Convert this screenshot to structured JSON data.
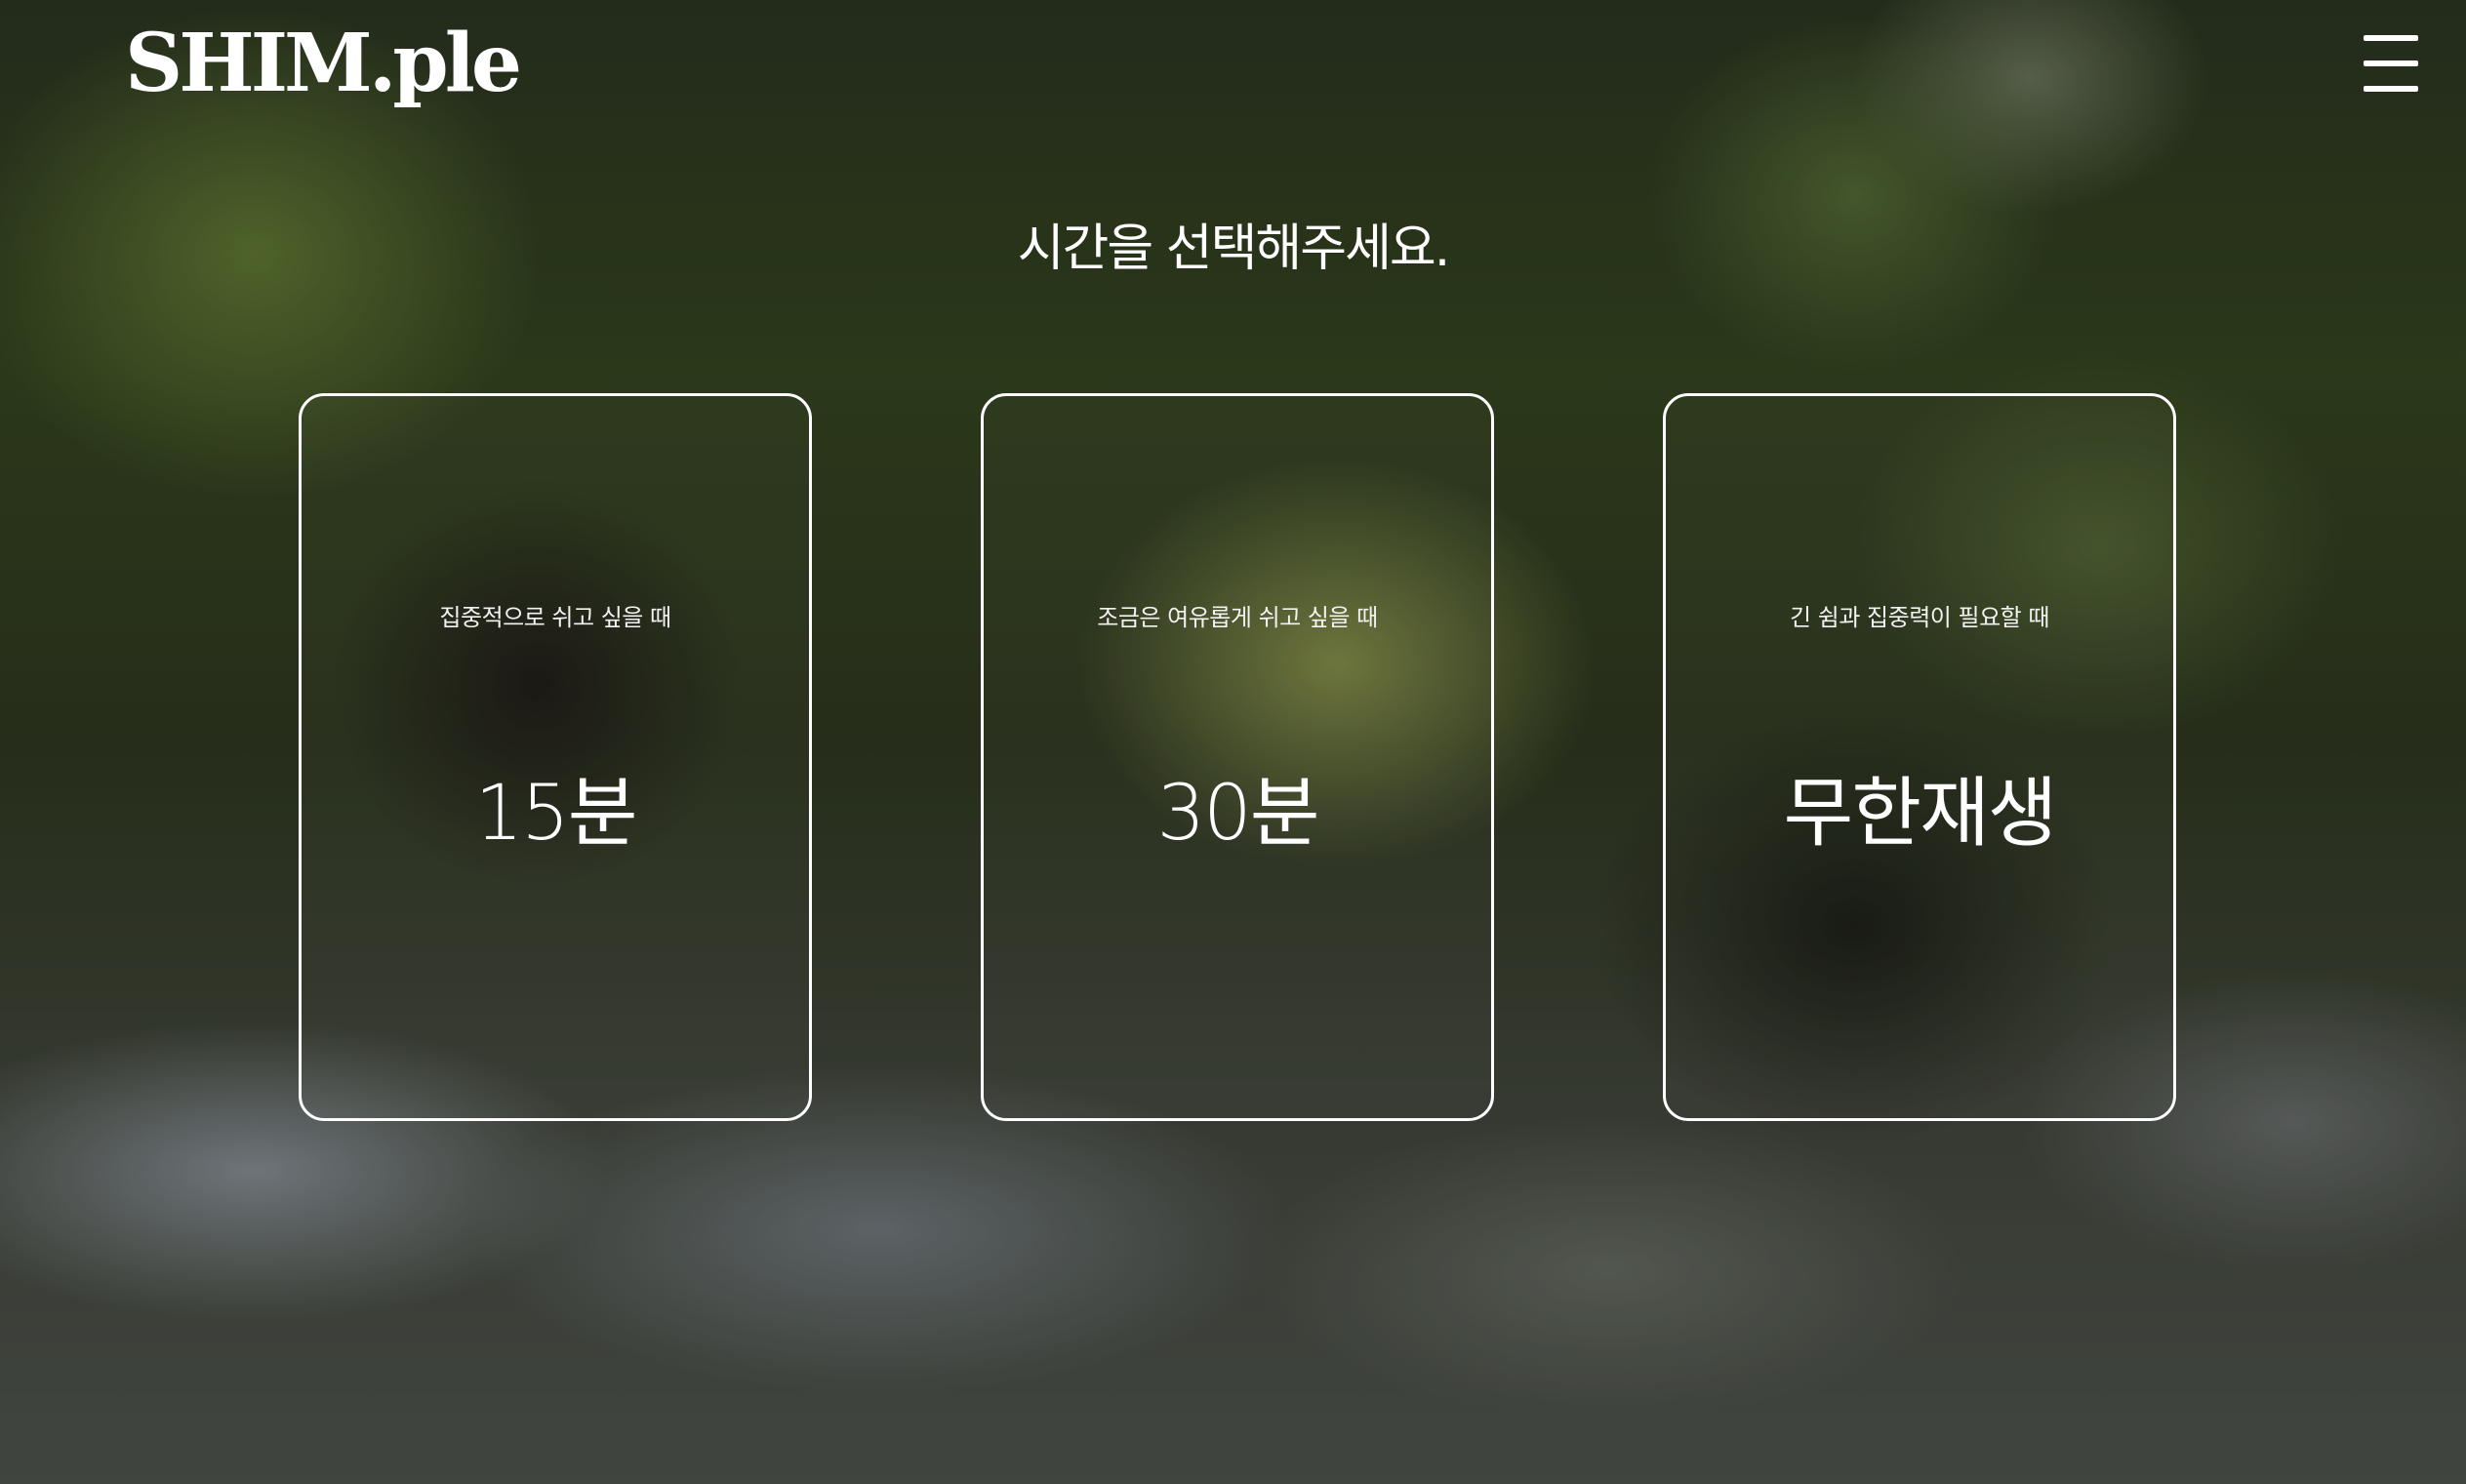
{
  "header": {
    "logo_text": "SHIM.ple",
    "menu_icon": "hamburger-menu-icon"
  },
  "main": {
    "title": "시간을 선택해주세요.",
    "cards": [
      {
        "description": "집중적으로 쉬고 싶을 때",
        "time": "15분"
      },
      {
        "description": "조금은 여유롭게 쉬고 싶을 때",
        "time": "30분"
      },
      {
        "description": "긴 쉼과 집중력이 필요할 때",
        "time": "무한재생"
      }
    ]
  },
  "colors": {
    "text": "#ffffff",
    "card_border": "#ffffff"
  }
}
